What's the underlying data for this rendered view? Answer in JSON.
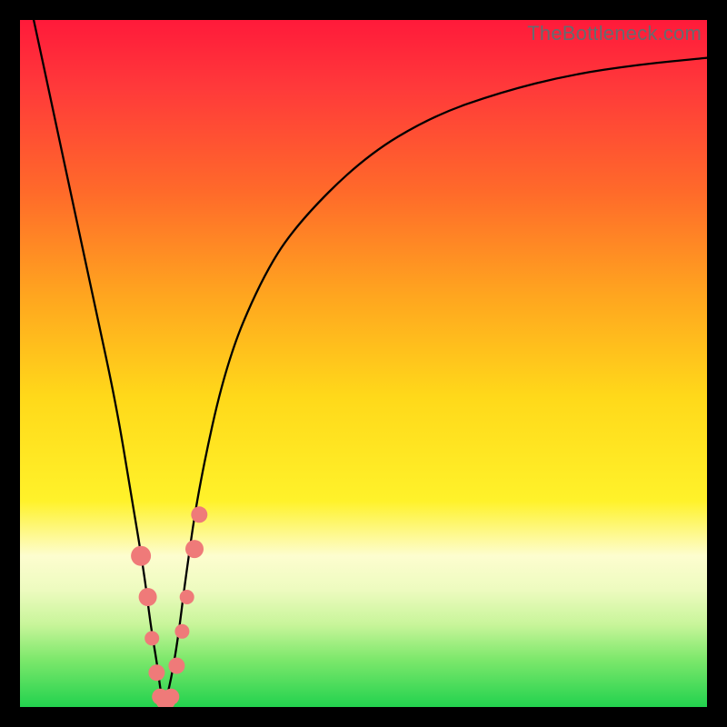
{
  "watermark": "TheBottleneck.com",
  "chart_data": {
    "type": "line",
    "title": "",
    "xlabel": "",
    "ylabel": "",
    "xlim": [
      0,
      100
    ],
    "ylim": [
      0,
      100
    ],
    "grid": false,
    "series": [
      {
        "name": "bottleneck-curve",
        "x": [
          2,
          5,
          8,
          11,
          14,
          16,
          18,
          19,
          20,
          20.5,
          21,
          22,
          23,
          24,
          26,
          30,
          35,
          40,
          50,
          60,
          70,
          80,
          90,
          100
        ],
        "y": [
          100,
          86,
          72,
          58,
          44,
          32,
          20,
          12,
          6,
          2,
          0,
          4,
          10,
          18,
          32,
          50,
          62,
          70,
          80,
          86,
          89.5,
          92,
          93.5,
          94.5
        ]
      }
    ],
    "markers": {
      "name": "highlighted-points",
      "color": "#ef7a79",
      "points": [
        {
          "x": 17.6,
          "y": 22,
          "r": 11
        },
        {
          "x": 18.6,
          "y": 16,
          "r": 10
        },
        {
          "x": 19.2,
          "y": 10,
          "r": 8
        },
        {
          "x": 19.9,
          "y": 5,
          "r": 9
        },
        {
          "x": 20.4,
          "y": 1.5,
          "r": 9
        },
        {
          "x": 21.2,
          "y": 1,
          "r": 11
        },
        {
          "x": 22.0,
          "y": 1.5,
          "r": 9
        },
        {
          "x": 22.8,
          "y": 6,
          "r": 9
        },
        {
          "x": 23.6,
          "y": 11,
          "r": 8
        },
        {
          "x": 24.3,
          "y": 16,
          "r": 8
        },
        {
          "x": 25.4,
          "y": 23,
          "r": 10
        },
        {
          "x": 26.1,
          "y": 28,
          "r": 9
        }
      ]
    },
    "background_gradient_stops": [
      {
        "pos": 0,
        "color": "#ff1a3a"
      },
      {
        "pos": 25,
        "color": "#ff6a2a"
      },
      {
        "pos": 55,
        "color": "#ffd91a"
      },
      {
        "pos": 78,
        "color": "#fdfdcf"
      },
      {
        "pos": 100,
        "color": "#22d24e"
      }
    ]
  }
}
